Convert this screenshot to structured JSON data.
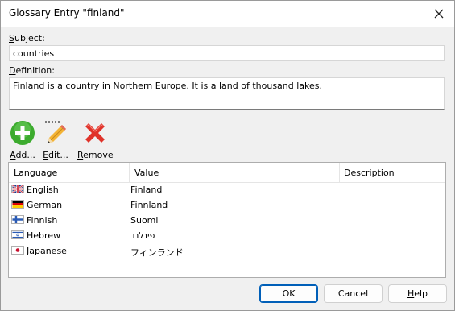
{
  "window": {
    "title": "Glossary Entry \"finland\""
  },
  "subject": {
    "label_hotkey": "S",
    "label_rest": "ubject:",
    "value": "countries"
  },
  "definition": {
    "label_hotkey": "D",
    "label_rest": "efinition:",
    "value": "Finland is a country in Northern Europe. It is a land of thousand lakes."
  },
  "toolbar": {
    "add": {
      "hotkey": "A",
      "rest": "dd..."
    },
    "edit": {
      "hotkey": "E",
      "rest": "dit..."
    },
    "remove": {
      "hotkey": "R",
      "rest": "emove"
    }
  },
  "table": {
    "columns": [
      "Language",
      "Value",
      "Description"
    ],
    "rows": [
      {
        "language": "English",
        "value": "Finland",
        "flag": "uk-flag-icon"
      },
      {
        "language": "German",
        "value": "Finnland",
        "flag": "germany-flag-icon"
      },
      {
        "language": "Finnish",
        "value": "Suomi",
        "flag": "finland-flag-icon"
      },
      {
        "language": "Hebrew",
        "value": "פינלנד",
        "flag": "israel-flag-icon"
      },
      {
        "language": "Japanese",
        "value": "フィンランド",
        "flag": "japan-flag-icon"
      }
    ]
  },
  "buttons": {
    "ok": "OK",
    "cancel": "Cancel",
    "help_hotkey": "H",
    "help_rest": "elp"
  },
  "colors": {
    "accent": "#005fb8",
    "add_green": "#3cab2e",
    "remove_red": "#e0332a"
  }
}
